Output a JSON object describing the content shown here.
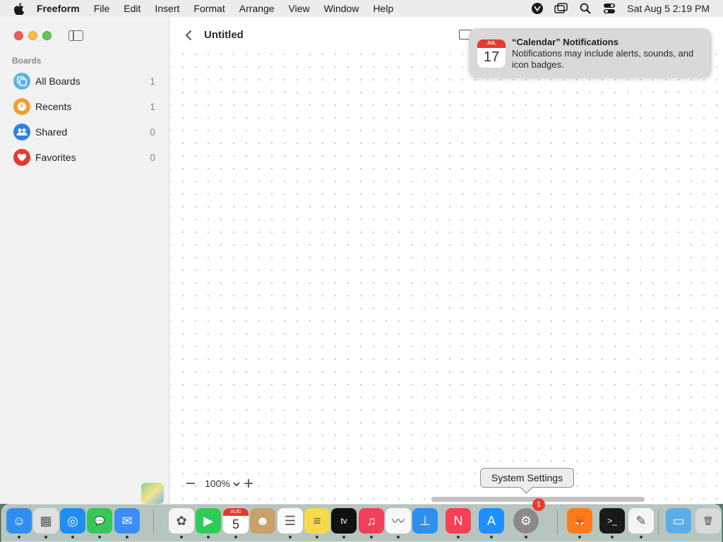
{
  "menubar": {
    "app_name": "Freeform",
    "menus": [
      "File",
      "Edit",
      "Insert",
      "Format",
      "Arrange",
      "View",
      "Window",
      "Help"
    ],
    "clock": "Sat Aug 5  2:19 PM",
    "status_icons": [
      "vpn-icon",
      "screen-mirroring-icon",
      "spotlight-search-icon",
      "control-center-icon"
    ]
  },
  "sidebar": {
    "heading": "Boards",
    "items": [
      {
        "label": "All Boards",
        "count": "1",
        "icon": "all-boards-icon",
        "color": "#5ab4e6"
      },
      {
        "label": "Recents",
        "count": "1",
        "icon": "clock-icon",
        "color": "#f0a030"
      },
      {
        "label": "Shared",
        "count": "0",
        "icon": "people-icon",
        "color": "#2f80e4"
      },
      {
        "label": "Favorites",
        "count": "0",
        "icon": "heart-icon",
        "color": "#e8372c"
      }
    ]
  },
  "board": {
    "title": "Untitled",
    "zoom": "100%"
  },
  "notification": {
    "title": "“Calendar” Notifications",
    "body": "Notifications may include alerts, sounds, and icon badges.",
    "icon_month": "JUL",
    "icon_day": "17"
  },
  "tooltip": {
    "text": "System Settings"
  },
  "dock": {
    "settings_badge": "1",
    "calendar_month": "AUG",
    "calendar_day": "5",
    "apps": [
      {
        "name": "finder-icon",
        "color": "#2f8ff0",
        "glyph": "☺"
      },
      {
        "name": "launchpad-icon",
        "color": "#e0e0e0",
        "glyph": "▦"
      },
      {
        "name": "safari-icon",
        "color": "#1e8ef0",
        "glyph": "◎"
      },
      {
        "name": "messages-icon",
        "color": "#34c759",
        "glyph": "💬"
      },
      {
        "name": "mail-icon",
        "color": "#3a8ef5",
        "glyph": "✉"
      },
      {
        "name": "photos-icon",
        "color": "#f4f4f4",
        "glyph": "✿"
      },
      {
        "name": "facetime-icon",
        "color": "#2ecc55",
        "glyph": "▶"
      },
      {
        "name": "calendar-icon",
        "color": "#ffffff",
        "glyph": ""
      },
      {
        "name": "contacts-icon",
        "color": "#c9a26b",
        "glyph": "☻"
      },
      {
        "name": "reminders-icon",
        "color": "#fafafa",
        "glyph": "☰"
      },
      {
        "name": "notes-icon",
        "color": "#f7d94c",
        "glyph": "≡"
      },
      {
        "name": "apple-tv-icon",
        "color": "#111111",
        "glyph": "tv"
      },
      {
        "name": "music-icon",
        "color": "#f2405a",
        "glyph": "♫"
      },
      {
        "name": "freeform-icon",
        "color": "#f8f8f8",
        "glyph": "〰"
      },
      {
        "name": "keynote-icon",
        "color": "#2f8ff0",
        "glyph": "⊥"
      },
      {
        "name": "news-icon",
        "color": "#f54055",
        "glyph": "N"
      },
      {
        "name": "app-store-icon",
        "color": "#1e90ff",
        "glyph": "A"
      },
      {
        "name": "system-settings-icon",
        "color": "#8a8a8a",
        "glyph": "⚙"
      },
      {
        "name": "firefox-icon",
        "color": "#ff7a1a",
        "glyph": "🦊"
      },
      {
        "name": "terminal-icon",
        "color": "#1a1a1a",
        "glyph": ">_"
      },
      {
        "name": "textedit-icon",
        "color": "#f4f4f4",
        "glyph": "✎"
      },
      {
        "name": "downloads-folder-icon",
        "color": "#5aaee8",
        "glyph": "▭"
      },
      {
        "name": "trash-icon",
        "color": "#d9d9d9",
        "glyph": "🗑"
      }
    ]
  }
}
